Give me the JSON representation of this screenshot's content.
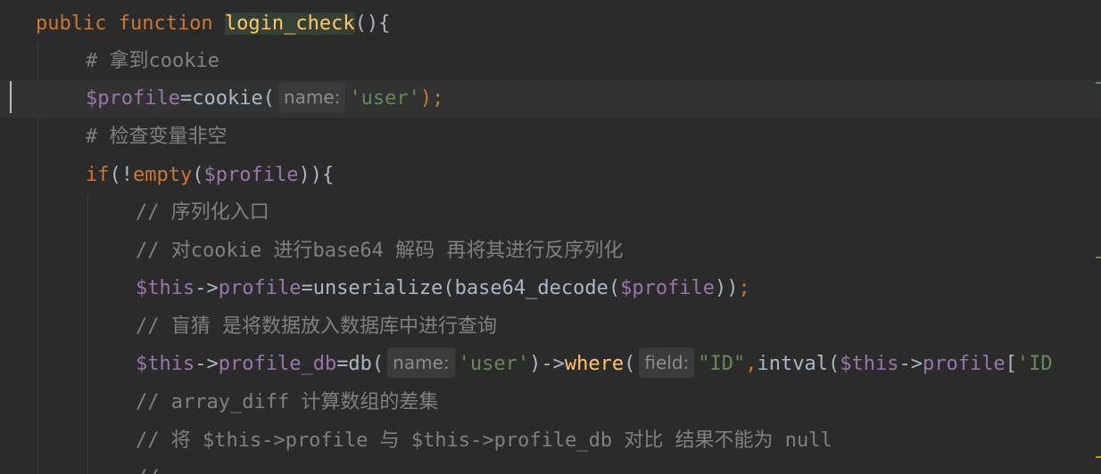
{
  "editor": {
    "lines": [
      {
        "tokens": [
          {
            "t": "public function ",
            "c": "kw"
          },
          {
            "t": "login_check",
            "c": "fn-hl"
          },
          {
            "t": "(){",
            "c": "plain"
          }
        ]
      },
      {
        "tokens": [
          {
            "t": "# 拿到cookie",
            "c": "cmt"
          }
        ]
      },
      {
        "tokens": [
          {
            "t": "$profile",
            "c": "var"
          },
          {
            "t": "=cookie(",
            "c": "plain"
          },
          {
            "t": "name:",
            "c": "hint"
          },
          {
            "t": "'user'",
            "c": "str"
          },
          {
            "t": ");",
            "c": "kw"
          }
        ]
      },
      {
        "tokens": [
          {
            "t": "# 检查变量非空",
            "c": "cmt"
          }
        ]
      },
      {
        "tokens": [
          {
            "t": "if",
            "c": "kw"
          },
          {
            "t": "(!",
            "c": "plain"
          },
          {
            "t": "empty",
            "c": "kw"
          },
          {
            "t": "(",
            "c": "plain"
          },
          {
            "t": "$profile",
            "c": "var"
          },
          {
            "t": ")){",
            "c": "plain"
          }
        ]
      },
      {
        "tokens": [
          {
            "t": "// 序列化入口",
            "c": "cmt"
          }
        ]
      },
      {
        "tokens": [
          {
            "t": "// 对cookie 进行base64 解码 再将其进行反序列化",
            "c": "cmt"
          }
        ]
      },
      {
        "tokens": [
          {
            "t": "$this",
            "c": "var"
          },
          {
            "t": "->",
            "c": "plain"
          },
          {
            "t": "profile",
            "c": "var"
          },
          {
            "t": "=unserialize(base64_decode(",
            "c": "plain"
          },
          {
            "t": "$profile",
            "c": "var"
          },
          {
            "t": "))",
            "c": "plain"
          },
          {
            "t": ";",
            "c": "kw"
          }
        ]
      },
      {
        "tokens": [
          {
            "t": "// 盲猜 是将数据放入数据库中进行查询",
            "c": "cmt"
          }
        ]
      },
      {
        "tokens": [
          {
            "t": "$this",
            "c": "var"
          },
          {
            "t": "->",
            "c": "plain"
          },
          {
            "t": "profile_db",
            "c": "var"
          },
          {
            "t": "=db(",
            "c": "plain"
          },
          {
            "t": "name:",
            "c": "hint"
          },
          {
            "t": "'user'",
            "c": "str"
          },
          {
            "t": ")->",
            "c": "plain"
          },
          {
            "t": "where",
            "c": "fn"
          },
          {
            "t": "(",
            "c": "plain"
          },
          {
            "t": "field:",
            "c": "hint"
          },
          {
            "t": "\"ID\"",
            "c": "str"
          },
          {
            "t": ",",
            "c": "kw"
          },
          {
            "t": "intval(",
            "c": "plain"
          },
          {
            "t": "$this",
            "c": "var"
          },
          {
            "t": "->",
            "c": "plain"
          },
          {
            "t": "profile",
            "c": "var"
          },
          {
            "t": "[",
            "c": "plain"
          },
          {
            "t": "'ID",
            "c": "str"
          }
        ]
      },
      {
        "tokens": [
          {
            "t": "// array_diff 计算数组的差集",
            "c": "cmt"
          }
        ]
      },
      {
        "tokens": [
          {
            "t": "// 将 $this->profile 与 $this->profile_db 对比 结果不能为 null",
            "c": "cmt"
          }
        ]
      },
      {
        "tokens": [
          {
            "t": "//",
            "c": "cmt"
          }
        ]
      }
    ]
  },
  "colors": {
    "background": "#2b2b2b",
    "current_line": "#323232",
    "keyword": "#cc7832",
    "function": "#ffc66d",
    "variable": "#9876aa",
    "string": "#6a8759",
    "comment": "#808080",
    "default_text": "#a9b7c6"
  }
}
